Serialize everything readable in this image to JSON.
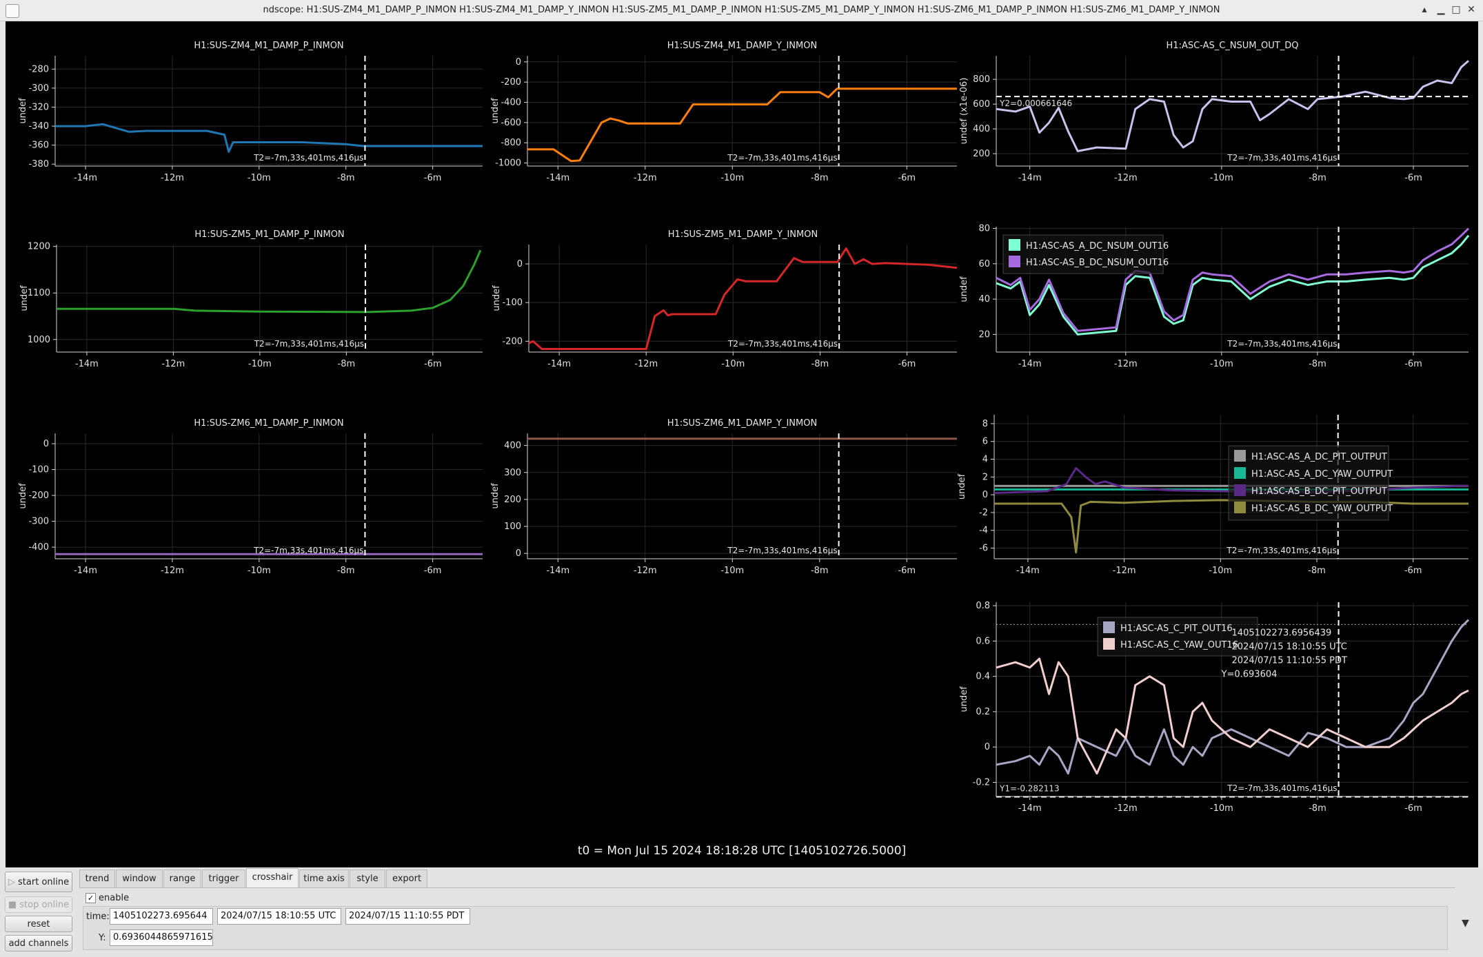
{
  "window": {
    "title": "ndscope: H1:SUS-ZM4_M1_DAMP_P_INMON H1:SUS-ZM4_M1_DAMP_Y_INMON H1:SUS-ZM5_M1_DAMP_P_INMON H1:SUS-ZM5_M1_DAMP_Y_INMON H1:SUS-ZM6_M1_DAMP_P_INMON H1:SUS-ZM6_M1_DAMP_Y_INMON",
    "buttons": {
      "min": "▁",
      "max": "□",
      "close": "✕",
      "shade": "▴"
    }
  },
  "t0_label": "t0 = Mon Jul 15 2024 18:18:28 UTC [1405102726.5000]",
  "crosshair_t2_label": "T2=-7m,33s,401ms,416µs",
  "x_axis": {
    "ticks": [
      -14,
      -12,
      -10,
      -8,
      -6
    ],
    "tick_labels": [
      "-14m",
      "-12m",
      "-10m",
      "-8m",
      "-6m"
    ],
    "range": [
      -14.7,
      -4.85
    ],
    "crosshair": -7.56
  },
  "colors": {
    "background": "#000000",
    "grid": "#2a2a2a",
    "axis": "#d8d8d8",
    "crosshair": "#ffffff"
  },
  "chart_data": [
    {
      "id": "zm4p",
      "type": "line",
      "title": "H1:SUS-ZM4_M1_DAMP_P_INMON",
      "ylabel": "undef",
      "ylim": [
        -382,
        -266
      ],
      "yticks": [
        -280,
        -300,
        -320,
        -340,
        -360,
        -380
      ],
      "series": [
        {
          "name": "H1:SUS-ZM4_M1_DAMP_P_INMON",
          "color": "#1f77b4",
          "x": [
            -14.7,
            -14.0,
            -13.6,
            -13.0,
            -12.6,
            -11.2,
            -10.8,
            -10.7,
            -10.6,
            -9.0,
            -8.0,
            -7.6,
            -4.85
          ],
          "y": [
            -340,
            -340,
            -338,
            -346,
            -345,
            -345,
            -349,
            -367,
            -357,
            -357,
            -359,
            -361,
            -361
          ]
        }
      ]
    },
    {
      "id": "zm4y",
      "type": "line",
      "title": "H1:SUS-ZM4_M1_DAMP_Y_INMON",
      "ylabel": "undef",
      "ylim": [
        -1030,
        60
      ],
      "yticks": [
        0,
        -200,
        -400,
        -600,
        -800,
        -1000
      ],
      "series": [
        {
          "name": "H1:SUS-ZM4_M1_DAMP_Y_INMON",
          "color": "#ff7f0e",
          "x": [
            -14.7,
            -14.1,
            -13.7,
            -13.5,
            -13.0,
            -12.8,
            -12.6,
            -12.4,
            -11.2,
            -10.9,
            -10.0,
            -9.2,
            -8.9,
            -8.0,
            -7.8,
            -7.6,
            -4.85
          ],
          "y": [
            -865,
            -865,
            -980,
            -975,
            -600,
            -560,
            -580,
            -610,
            -610,
            -420,
            -420,
            -420,
            -300,
            -300,
            -350,
            -265,
            -265
          ]
        }
      ]
    },
    {
      "id": "zm5p",
      "type": "line",
      "title": "H1:SUS-ZM5_M1_DAMP_P_INMON",
      "ylabel": "undef",
      "ylim": [
        973,
        1204
      ],
      "yticks": [
        1200,
        1100,
        1000
      ],
      "series": [
        {
          "name": "H1:SUS-ZM5_M1_DAMP_P_INMON",
          "color": "#2ca02c",
          "x": [
            -14.7,
            -12.0,
            -11.5,
            -10.0,
            -7.5,
            -6.5,
            -6.0,
            -5.6,
            -5.3,
            -5.05,
            -4.9
          ],
          "y": [
            1066,
            1066,
            1062,
            1060,
            1059,
            1062,
            1068,
            1085,
            1115,
            1160,
            1192
          ]
        }
      ]
    },
    {
      "id": "zm5y",
      "type": "line",
      "title": "H1:SUS-ZM5_M1_DAMP_Y_INMON",
      "ylabel": "undef",
      "ylim": [
        -228,
        50
      ],
      "yticks": [
        0,
        -100,
        -200
      ],
      "series": [
        {
          "name": "H1:SUS-ZM5_M1_DAMP_Y_INMON",
          "color": "#d62728",
          "x": [
            -14.7,
            -14.6,
            -14.4,
            -12.0,
            -11.8,
            -11.6,
            -11.5,
            -11.4,
            -10.4,
            -10.2,
            -9.9,
            -9.7,
            -9.0,
            -8.6,
            -8.4,
            -7.6,
            -7.4,
            -7.2,
            -7.0,
            -6.8,
            -6.5,
            -5.5,
            -4.85
          ],
          "y": [
            -205,
            -200,
            -220,
            -220,
            -135,
            -120,
            -133,
            -130,
            -130,
            -80,
            -40,
            -45,
            -45,
            15,
            5,
            5,
            40,
            0,
            12,
            0,
            2,
            -2,
            -10
          ]
        }
      ]
    },
    {
      "id": "zm6p",
      "type": "line",
      "title": "H1:SUS-ZM6_M1_DAMP_P_INMON",
      "ylabel": "undef",
      "ylim": [
        -445,
        40
      ],
      "yticks": [
        0,
        -100,
        -200,
        -300,
        -400
      ],
      "series": [
        {
          "name": "H1:SUS-ZM6_M1_DAMP_P_INMON",
          "color": "#9467bd",
          "x": [
            -14.7,
            -4.85
          ],
          "y": [
            -427,
            -427
          ]
        }
      ]
    },
    {
      "id": "zm6y",
      "type": "line",
      "title": "H1:SUS-ZM6_M1_DAMP_Y_INMON",
      "ylabel": "undef",
      "ylim": [
        -20,
        445
      ],
      "yticks": [
        400,
        300,
        200,
        100,
        0
      ],
      "series": [
        {
          "name": "H1:SUS-ZM6_M1_DAMP_Y_INMON",
          "color": "#8c564b",
          "x": [
            -14.7,
            -4.85
          ],
          "y": [
            425,
            425
          ]
        }
      ]
    },
    {
      "id": "nsum",
      "type": "line",
      "title": "H1:ASC-AS_C_NSUM_OUT_DQ",
      "ylabel": "undef (x1e-06)",
      "ylim": [
        100,
        990
      ],
      "yticks": [
        800,
        600,
        400,
        200
      ],
      "hline": 661,
      "hline_label": "Y2=0.000661646",
      "series": [
        {
          "name": "H1:ASC-AS_C_NSUM_OUT_DQ",
          "color": "#c8c3ec",
          "x": [
            -14.7,
            -14.3,
            -14.0,
            -13.8,
            -13.6,
            -13.4,
            -13.2,
            -13.0,
            -12.6,
            -12.0,
            -11.8,
            -11.5,
            -11.2,
            -11.0,
            -10.8,
            -10.6,
            -10.4,
            -10.2,
            -9.8,
            -9.4,
            -9.2,
            -9.0,
            -8.6,
            -8.2,
            -8.0,
            -7.5,
            -7.0,
            -6.5,
            -6.2,
            -6.0,
            -5.8,
            -5.5,
            -5.2,
            -5.0,
            -4.85
          ],
          "y": [
            560,
            540,
            580,
            370,
            450,
            570,
            380,
            220,
            250,
            240,
            560,
            640,
            620,
            350,
            250,
            300,
            560,
            640,
            620,
            620,
            470,
            520,
            640,
            560,
            640,
            660,
            700,
            650,
            640,
            650,
            740,
            790,
            770,
            900,
            950
          ]
        }
      ]
    },
    {
      "id": "dcnsum",
      "type": "line",
      "title": "",
      "ylabel": "undef",
      "ylim": [
        10,
        81
      ],
      "yticks": [
        80,
        60,
        40,
        20
      ],
      "legend": "top-left",
      "series": [
        {
          "name": "H1:ASC-AS_A_DC_NSUM_OUT16",
          "color": "#7fffd4",
          "x": [
            -14.7,
            -14.4,
            -14.2,
            -14.0,
            -13.8,
            -13.6,
            -13.3,
            -13.0,
            -12.6,
            -12.2,
            -12.0,
            -11.8,
            -11.5,
            -11.2,
            -11.0,
            -10.8,
            -10.6,
            -10.4,
            -10.2,
            -9.8,
            -9.4,
            -9.0,
            -8.6,
            -8.2,
            -7.8,
            -7.4,
            -7.0,
            -6.5,
            -6.2,
            -6.0,
            -5.8,
            -5.5,
            -5.2,
            -5.0,
            -4.85
          ],
          "y": [
            49,
            46,
            50,
            31,
            37,
            48,
            30,
            20,
            21,
            22,
            48,
            53,
            52,
            30,
            26,
            28,
            48,
            52,
            51,
            50,
            40,
            47,
            51,
            48,
            50,
            50,
            51,
            52,
            51,
            52,
            58,
            62,
            66,
            71,
            76
          ]
        },
        {
          "name": "H1:ASC-AS_B_DC_NSUM_OUT16",
          "color": "#a76be0",
          "x": [
            -14.7,
            -14.4,
            -14.2,
            -14.0,
            -13.8,
            -13.6,
            -13.3,
            -13.0,
            -12.6,
            -12.2,
            -12.0,
            -11.8,
            -11.5,
            -11.2,
            -11.0,
            -10.8,
            -10.6,
            -10.4,
            -10.2,
            -9.8,
            -9.4,
            -9.0,
            -8.6,
            -8.2,
            -7.8,
            -7.4,
            -7.0,
            -6.5,
            -6.2,
            -6.0,
            -5.8,
            -5.5,
            -5.2,
            -5.0,
            -4.85
          ],
          "y": [
            52,
            48,
            52,
            34,
            40,
            51,
            32,
            22,
            23,
            24,
            51,
            56,
            55,
            33,
            28,
            31,
            51,
            55,
            54,
            53,
            43,
            50,
            54,
            51,
            54,
            54,
            55,
            56,
            55,
            56,
            62,
            67,
            71,
            76,
            80
          ]
        }
      ]
    },
    {
      "id": "dcout",
      "type": "line",
      "title": "",
      "ylabel": "undef",
      "ylim": [
        -7.2,
        9
      ],
      "yticks": [
        8,
        6,
        4,
        2,
        0,
        -2,
        -4,
        -6
      ],
      "legend": "top-right",
      "series": [
        {
          "name": "H1:ASC-AS_A_DC_PIT_OUTPUT",
          "color": "#9a9a9a",
          "x": [
            -14.7,
            -4.85
          ],
          "y": [
            1.0,
            1.0
          ]
        },
        {
          "name": "H1:ASC-AS_A_DC_YAW_OUTPUT",
          "color": "#19b795",
          "x": [
            -14.7,
            -4.85
          ],
          "y": [
            0.6,
            0.6
          ]
        },
        {
          "name": "H1:ASC-AS_B_DC_PIT_OUTPUT",
          "color": "#5b2a86",
          "x": [
            -14.7,
            -13.6,
            -13.2,
            -13.0,
            -12.8,
            -12.6,
            -12.4,
            -12.0,
            -11.0,
            -10.0,
            -9.0,
            -8.0,
            -7.0,
            -6.0,
            -5.0,
            -4.85
          ],
          "y": [
            0.2,
            0.4,
            1.2,
            3.0,
            2.0,
            1.2,
            1.5,
            0.8,
            0.5,
            0.4,
            0.3,
            0.3,
            0.5,
            0.8,
            1.0,
            1.0
          ]
        },
        {
          "name": "H1:ASC-AS_B_DC_YAW_OUTPUT",
          "color": "#8f8a3c",
          "x": [
            -14.7,
            -13.3,
            -13.1,
            -13.0,
            -12.9,
            -12.7,
            -12.0,
            -11.0,
            -10.0,
            -9.0,
            -8.0,
            -7.0,
            -6.0,
            -5.0,
            -4.85
          ],
          "y": [
            -1.0,
            -1.0,
            -2.5,
            -6.5,
            -1.2,
            -0.8,
            -0.9,
            -0.7,
            -0.6,
            -0.7,
            -0.8,
            -0.8,
            -1.0,
            -1.0,
            -1.0
          ]
        }
      ]
    },
    {
      "id": "cpy",
      "type": "line",
      "title": "",
      "ylabel": "undef",
      "ylim": [
        -0.28,
        0.82
      ],
      "yticks": [
        0.8,
        0.6,
        0.4,
        0.2,
        0,
        -0.2
      ],
      "legend": "top-center",
      "hline_top": 0.693604,
      "hline": -0.282113,
      "hline_label": "Y1=-0.282113",
      "readout": [
        "1405102273.6956439",
        "2024/07/15 18:10:55 UTC",
        "2024/07/15 11:10:55 PDT",
        "Y=0.693604"
      ],
      "series": [
        {
          "name": "H1:ASC-AS_C_PIT_OUT16",
          "color": "#a9a6c4",
          "x": [
            -14.7,
            -14.3,
            -14.0,
            -13.8,
            -13.6,
            -13.4,
            -13.2,
            -13.0,
            -12.6,
            -12.2,
            -12.0,
            -11.8,
            -11.5,
            -11.2,
            -11.0,
            -10.8,
            -10.6,
            -10.4,
            -10.2,
            -9.8,
            -9.4,
            -9.0,
            -8.6,
            -8.2,
            -7.8,
            -7.4,
            -7.0,
            -6.5,
            -6.2,
            -6.0,
            -5.8,
            -5.5,
            -5.2,
            -5.0,
            -4.85
          ],
          "y": [
            -0.1,
            -0.08,
            -0.05,
            -0.1,
            0.0,
            -0.05,
            -0.15,
            0.05,
            0.0,
            -0.05,
            0.05,
            -0.05,
            -0.1,
            0.1,
            -0.05,
            -0.1,
            0.0,
            -0.05,
            0.05,
            0.1,
            0.05,
            0.0,
            -0.05,
            0.08,
            0.05,
            0.0,
            0.0,
            0.05,
            0.15,
            0.25,
            0.3,
            0.45,
            0.6,
            0.68,
            0.72
          ]
        },
        {
          "name": "H1:ASC-AS_C_YAW_OUT16",
          "color": "#f2cfcf",
          "x": [
            -14.7,
            -14.3,
            -14.0,
            -13.8,
            -13.6,
            -13.4,
            -13.2,
            -13.0,
            -12.6,
            -12.2,
            -12.0,
            -11.8,
            -11.5,
            -11.2,
            -11.0,
            -10.8,
            -10.6,
            -10.4,
            -10.2,
            -9.8,
            -9.4,
            -9.0,
            -8.6,
            -8.2,
            -7.8,
            -7.4,
            -7.0,
            -6.5,
            -6.2,
            -6.0,
            -5.8,
            -5.5,
            -5.2,
            -5.0,
            -4.85
          ],
          "y": [
            0.45,
            0.48,
            0.45,
            0.5,
            0.3,
            0.48,
            0.4,
            0.05,
            -0.15,
            0.1,
            0.05,
            0.35,
            0.4,
            0.35,
            0.05,
            0.0,
            0.2,
            0.25,
            0.15,
            0.05,
            0.0,
            0.1,
            0.05,
            0.0,
            0.1,
            0.05,
            0.0,
            0.0,
            0.05,
            0.1,
            0.15,
            0.2,
            0.25,
            0.3,
            0.32
          ]
        }
      ]
    }
  ],
  "controls": {
    "start_online": "start online",
    "stop_online": "stop online",
    "reset": "reset",
    "add_channels": "add channels",
    "tabs": [
      "trend",
      "window",
      "range",
      "trigger",
      "crosshair",
      "time axis",
      "style",
      "export"
    ],
    "active_tab": "crosshair",
    "enable_label": "enable",
    "enable_checked": true,
    "time_label": "time:",
    "time_gps": "1405102273.695644",
    "time_utc": "2024/07/15 18:10:55 UTC",
    "time_local": "2024/07/15 11:10:55 PDT",
    "y_label": "Y:",
    "y_value": "0.6936044865971615",
    "collapse_icon": "chevron-down-icon"
  }
}
